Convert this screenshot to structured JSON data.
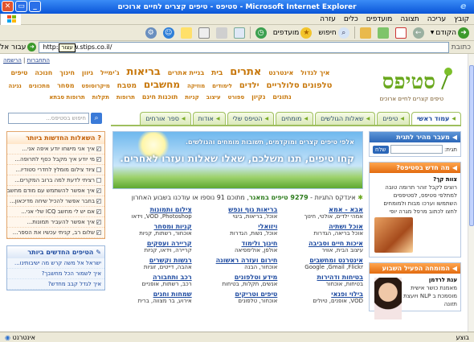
{
  "window": {
    "title": "סטיפס - טיפים קצרים לחיים ארוכים - Microsoft Internet Explorer"
  },
  "menu": [
    "קובץ",
    "עריכה",
    "תצוגה",
    "מועדפים",
    "כלים",
    "עזרה"
  ],
  "toolbar": {
    "back": "הקודם",
    "search": "חיפוש",
    "favorites": "מועדפים"
  },
  "address": {
    "label": "כתובת",
    "url": "http://www.stips.co.il/",
    "go": "עבור אל",
    "tooltip": "עצור"
  },
  "page": {
    "toplinks": {
      "register": "התחברות",
      "separator": "|",
      "login": "הרשמה"
    },
    "logo": {
      "name": "סטיפס",
      "tagline": "טיפים קצרים לחיים ארוכים"
    },
    "tags": [
      "איך לגדול",
      "אינטרנט",
      "אתרים",
      "בית",
      "בניית אתרים",
      "בריאות",
      "ג'ימייל",
      "גיוון",
      "חינוך",
      "חנוכה",
      "טיפים",
      "טלפונים סלולריים",
      "ילדים",
      "לימודים",
      "מוזיקה",
      "מחשבים",
      "מטבח",
      "מיקרוסופט",
      "מסחר",
      "מתכונים",
      "נגינה",
      "נתונים",
      "נקיון",
      "ספורט",
      "עיצוב",
      "קניות",
      "תוכנות חינם",
      "תרופות",
      "תקלות",
      "תרופות סבתא"
    ],
    "tabs": [
      "עמוד ראשי",
      "טיפים",
      "שאלות הגולשים",
      "מומחים",
      "הטיפס שלי",
      "אודות",
      "ספר אורחים"
    ],
    "search_placeholder": "חיפוש בסטיפס...",
    "banner": {
      "line1": "אלפי טיפים קצרים ומוקדמים, תשובות מומחים והגולשים.",
      "line2": "קחו טיפים, תנו משלכם, שאלו שאלות ועזרו לאחרים."
    },
    "stats": {
      "prefix": "אינדקס התגיות - ",
      "count": "9279 טיפים במאגר",
      "suffix": ", מתוכם 91 נוספו או עודכנו בשבוע האחרון"
    },
    "categories": [
      {
        "title": "אבא - אמא",
        "sub": "אמהי ילדים, אולטי, חינוך"
      },
      {
        "title": "בריאות גוף ונפש",
        "sub": "אוכל, בריאות, ביגוי"
      },
      {
        "title": "צילום ותמונות",
        "sub": "VOD ,Photoshop, וידאו"
      },
      {
        "title": "אוכל ושתיה",
        "sub": "אוכל בריאה, הגדרות"
      },
      {
        "title": "ויזואלי",
        "sub": "אוכל, נשות, הגדרות"
      },
      {
        "title": "קניות ומסחר",
        "sub": "אוכחור, רשתות, קניות"
      },
      {
        "title": "איכות חיים וסביבה",
        "sub": "עיצוב הבית, אוויר"
      },
      {
        "title": "חינוך ולימוד",
        "sub": "אולפן, אולימפיאה"
      },
      {
        "title": "קריירה ועסקים",
        "sub": "קריירה, וידאו, קניות"
      },
      {
        "title": "אינטרנט ומחשבים",
        "sub": "Google ,Gmail ,Flickr"
      },
      {
        "title": "חירום ועזרה ראשונה",
        "sub": "אוכחור, הבנה"
      },
      {
        "title": "רגשות וקשרים",
        "sub": "אהבה, דייטים, זוגיות"
      },
      {
        "title": "בטיחות ודהירות",
        "sub": "בטיחות, אוכחור"
      },
      {
        "title": "מידע וטלפונים",
        "sub": "אנשים, תקלות, בטיחות"
      },
      {
        "title": "רכב ותחבורה",
        "sub": "רכב, רשתות, אופניים"
      },
      {
        "title": "בילוי ופנאי",
        "sub": "VOD, אופנים, טיולים"
      },
      {
        "title": "טיפים וטריקים",
        "sub": "אוכחור, טלפונים"
      },
      {
        "title": "שמחות וחגים",
        "sub": "אירוע, בר מצווה, ברית"
      }
    ],
    "right": {
      "search_title": "מעבר מהיר לתגית",
      "search_label": "תגית:",
      "search_btn": "שלח",
      "new_title": "מה חדש בסטיפס?",
      "new_head": "צוות קך?",
      "new_text": "רוצים לקבל זוהר תרומה טובה למתלפי סטיפס, לסטיפסים השתמשו וערכו מבות ולמומחים לחצו לכתוב מרפל מגרה יופי",
      "expert_title": "המומחה הפעיל השבוע",
      "expert_name": "ענת לרדמן",
      "expert_text": "מאמנת כושר אישית מוסמכת ב NLP ויועצת תזונה"
    },
    "left": {
      "questions_title": "השאלות החדשות ביותר",
      "questions": [
        "איך אני מישחו יודע איפה אני...",
        "מי יודע איך מקבל כסף לתרופה...",
        "ציוד צילום מומלץ לחדרי סטודיו...",
        "רציתי לדעת למה ברוב המקרים...",
        "איך אפשר להשתמש עם מודם מחשב...",
        "בחבר אפשר להכיל שיחה מדיכאון...",
        "אם יש לי מחשב ICQ שלי אני...",
        "איך אפשר להעביר תמונות...",
        "שלום רב, קניתי עכשיו את הספר..."
      ],
      "tips_title": "הטיפים החדשים ביותר",
      "tips": [
        "ישראל אל משה קרש מה ישיבותינו...",
        "איך לשמור הכל מחשבך?",
        "איך לגדל קבב מחדש?"
      ]
    },
    "status": {
      "text": "בוצע",
      "zone": "אינטרנט"
    }
  }
}
